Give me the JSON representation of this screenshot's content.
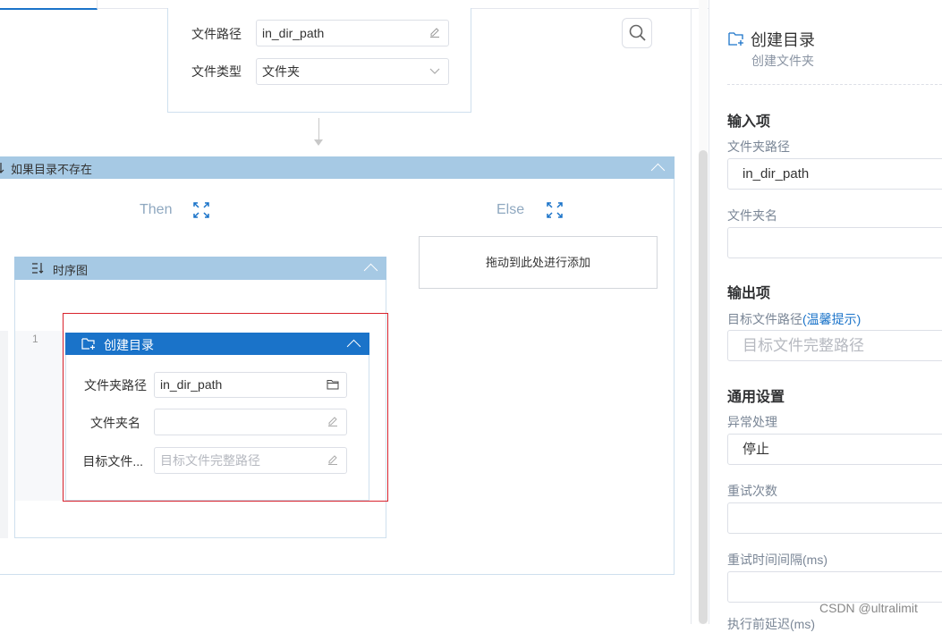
{
  "top_node": {
    "fields": [
      {
        "label": "文件路径",
        "value": "in_dir_path"
      },
      {
        "label": "文件类型",
        "value": "文件夹"
      }
    ]
  },
  "if_block": {
    "title": "如果目录不存在",
    "then_label": "Then",
    "else_label": "Else",
    "drop_hint": "拖动到此处进行添加"
  },
  "sequence": {
    "title": "时序图",
    "line_number": "1"
  },
  "create_dir_node": {
    "title": "创建目录",
    "fields": [
      {
        "label": "文件夹路径",
        "value": "in_dir_path",
        "placeholder": ""
      },
      {
        "label": "文件夹名",
        "value": "",
        "placeholder": ""
      },
      {
        "label": "目标文件...",
        "value": "",
        "placeholder": "目标文件完整路径"
      }
    ]
  },
  "right_panel": {
    "title": "创建目录",
    "subtitle": "创建文件夹",
    "input_section": "输入项",
    "folder_path_label": "文件夹路径",
    "folder_path_value": "in_dir_path",
    "folder_name_label": "文件夹名",
    "folder_name_value": "",
    "output_section": "输出项",
    "target_path_label": "目标文件路径",
    "target_path_hint": "(温馨提示)",
    "target_path_placeholder": "目标文件完整路径",
    "general_section": "通用设置",
    "exception_label": "异常处理",
    "exception_value": "停止",
    "retry_count_label": "重试次数",
    "retry_count_value": "",
    "retry_interval_label": "重试时间间隔(ms)",
    "retry_interval_value": "",
    "cutoff_label": "执行前延迟(ms)"
  },
  "watermark": "CSDN @ultralimit",
  "colors": {
    "accent": "#1a73c9",
    "header_light": "#a6c9e4",
    "highlight_border": "#d9232d"
  }
}
